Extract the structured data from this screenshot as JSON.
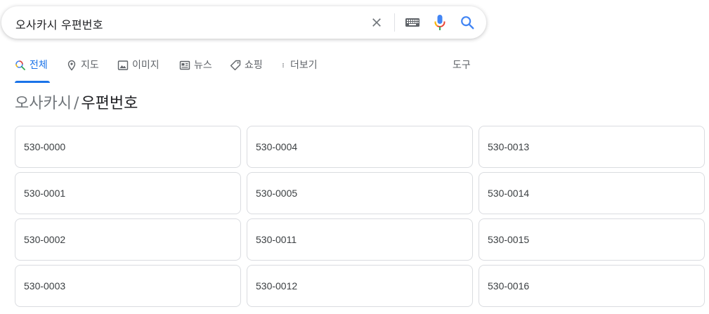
{
  "search": {
    "query": "오사카시 우편번호"
  },
  "tabs": [
    {
      "label": "전체",
      "icon": "search-icon",
      "active": true
    },
    {
      "label": "지도",
      "icon": "map-pin-icon",
      "active": false
    },
    {
      "label": "이미지",
      "icon": "image-icon",
      "active": false
    },
    {
      "label": "뉴스",
      "icon": "news-icon",
      "active": false
    },
    {
      "label": "쇼핑",
      "icon": "tag-icon",
      "active": false
    },
    {
      "label": "더보기",
      "icon": "more-vert-icon",
      "active": false
    },
    {
      "label": "도구",
      "icon": "",
      "active": false
    }
  ],
  "breadcrumb": {
    "parent": "오사카시",
    "separator": "/",
    "current": "우편번호"
  },
  "postal_codes": [
    "530-0000",
    "530-0004",
    "530-0013",
    "530-0001",
    "530-0005",
    "530-0014",
    "530-0002",
    "530-0011",
    "530-0015",
    "530-0003",
    "530-0012",
    "530-0016"
  ],
  "colors": {
    "accent": "#1a73e8",
    "text_secondary": "#5f6368",
    "card_border": "#dadce0"
  }
}
